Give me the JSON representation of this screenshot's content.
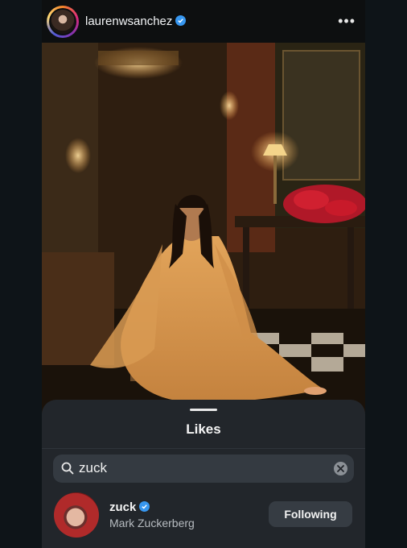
{
  "post": {
    "username": "laurenwsanchez",
    "verified_icon": "verified-badge-icon",
    "more_icon": "more-horizontal-icon",
    "more_label": "•••"
  },
  "likes_sheet": {
    "title": "Likes",
    "search": {
      "value": "zuck",
      "icon": "search-icon",
      "clear_icon": "clear-icon"
    },
    "results": [
      {
        "username": "zuck",
        "full_name": "Mark Zuckerberg",
        "verified": true,
        "button_label": "Following"
      }
    ]
  },
  "colors": {
    "verified": "#3797f0",
    "sheet_bg": "#22262b",
    "search_bg": "#343a41",
    "button_bg": "#363c43"
  }
}
